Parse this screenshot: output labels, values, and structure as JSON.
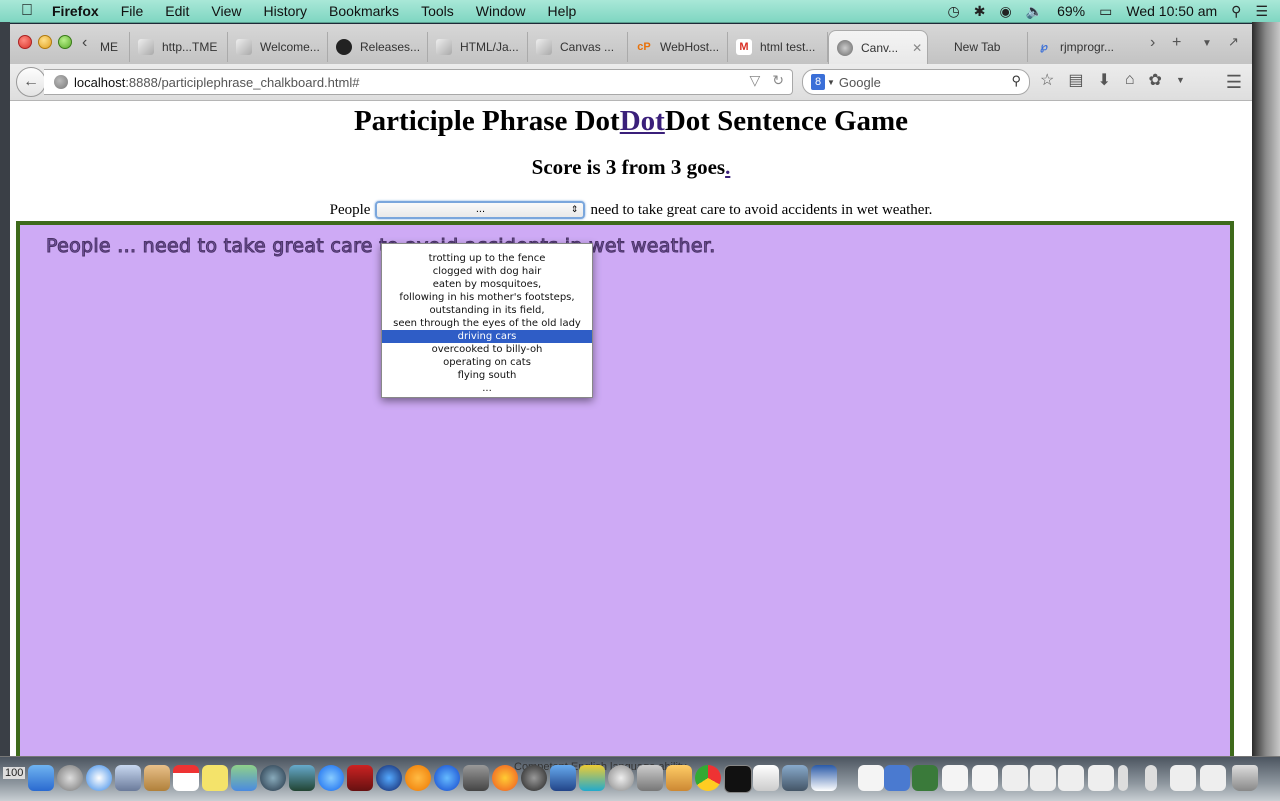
{
  "menubar": {
    "apple_icon": "apple-logo-icon",
    "items": [
      "Firefox",
      "File",
      "Edit",
      "View",
      "History",
      "Bookmarks",
      "Tools",
      "Window",
      "Help"
    ],
    "status": {
      "time_machine_icon": "time-machine-icon",
      "bluetooth_icon": "bluetooth-icon",
      "wifi_icon": "wifi-icon",
      "volume_icon": "volume-icon",
      "battery": "69%",
      "clock": "Wed 10:50 am",
      "spotlight_icon": "spotlight-icon",
      "notifications_icon": "notification-center-icon"
    }
  },
  "browser": {
    "tabs": [
      {
        "label": "ME",
        "icon": "page-icon"
      },
      {
        "label": "http...TME",
        "icon": "page-icon"
      },
      {
        "label": "Welcome...",
        "icon": "page-icon"
      },
      {
        "label": "Releases...",
        "icon": "github-icon"
      },
      {
        "label": "HTML/Ja...",
        "icon": "page-icon"
      },
      {
        "label": "Canvas ...",
        "icon": "page-icon"
      },
      {
        "label": "WebHost...",
        "icon": "cpanel-icon"
      },
      {
        "label": "html test...",
        "icon": "gmail-icon"
      },
      {
        "label": "Canv...",
        "icon": "globe-icon",
        "active": true
      },
      {
        "label": "New Tab",
        "icon": ""
      },
      {
        "label": "rjmprogr...",
        "icon": "wordpress-icon"
      }
    ],
    "url": {
      "host": "localhost",
      "path": ":8888/participlephrase_chalkboard.html#"
    },
    "search": {
      "engine": "Google",
      "placeholder": "Google"
    }
  },
  "page": {
    "title_prefix": "Participle Phrase Dot",
    "title_link": "Dot",
    "title_suffix": "Dot Sentence Game",
    "score_text": "Score is 3 from 3 goes",
    "score_link": ".",
    "sentence_start": "People",
    "select_value": "...",
    "sentence_end": "need to take great care to avoid accidents in wet weather.",
    "chalkboard_text": "People ... need to take great care to avoid accidents in wet weather.",
    "dropdown_options": [
      "trotting up to the fence",
      "clogged with dog hair",
      "eaten by mosquitoes,",
      "following in his mother's footsteps,",
      "outstanding in its field,",
      "seen through the eyes of the old lady",
      "driving cars",
      "overcooked to billy-oh",
      "operating on cats",
      "flying south",
      "..."
    ],
    "highlighted_option": "driving cars",
    "colors": {
      "chalkboard_bg": "#ceaaf5",
      "chalkboard_border": "#3e6a1b",
      "link": "#3a1f7a",
      "highlight": "#2f5dc6"
    }
  },
  "dock": {
    "tooltip": "Competent English language ability",
    "left_label": "100"
  }
}
